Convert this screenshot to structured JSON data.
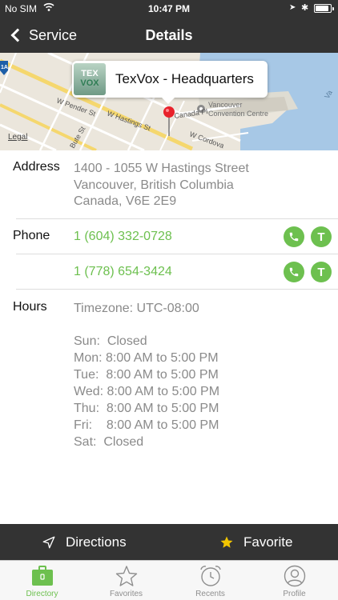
{
  "status_bar": {
    "carrier": "No SIM",
    "wifi_icon": "wifi-icon",
    "time": "10:47 PM",
    "battery_level": 0.9
  },
  "nav": {
    "back_label": "Service",
    "title": "Details"
  },
  "map": {
    "callout_title": "TexVox - Headquarters",
    "logo_text_line1": "TEX",
    "logo_text_line2": "VOX",
    "legal_label": "Legal",
    "street_labels": [
      "W Pender St",
      "W Hastings St",
      "Canada Pl",
      "W Cordova",
      "Bute St"
    ],
    "poi_label_line1": "Vancouver",
    "poi_label_line2": "Convention Centre",
    "highway_badge": "1A",
    "edge_label": "Va"
  },
  "address": {
    "label": "Address",
    "line1": "1400 - 1055 W Hastings Street",
    "line2": "Vancouver, British Columbia",
    "line3": "Canada, V6E 2E9"
  },
  "phone": {
    "label": "Phone",
    "numbers": [
      "1 (604) 332-0728",
      "1 (778) 654-3424"
    ],
    "text_glyph": "T"
  },
  "hours": {
    "label": "Hours",
    "timezone": "Timezone: UTC-08:00",
    "days": [
      {
        "day": "Sun:",
        "time": "Closed"
      },
      {
        "day": "Mon:",
        "time": "8:00 AM to 5:00 PM"
      },
      {
        "day": "Tue:",
        "time": "8:00 AM to 5:00 PM"
      },
      {
        "day": "Wed:",
        "time": "8:00 AM to 5:00 PM"
      },
      {
        "day": "Thu:",
        "time": "8:00 AM to 5:00 PM"
      },
      {
        "day": "Fri:",
        "time": "8:00 AM to 5:00 PM"
      },
      {
        "day": "Sat:",
        "time": "Closed"
      }
    ]
  },
  "actions": {
    "directions_label": "Directions",
    "favorite_label": "Favorite"
  },
  "tabs": [
    {
      "label": "Directory",
      "icon": "briefcase-icon",
      "active": true
    },
    {
      "label": "Favorites",
      "icon": "star-icon",
      "active": false
    },
    {
      "label": "Recents",
      "icon": "alarm-clock-icon",
      "active": false
    },
    {
      "label": "Profile",
      "icon": "person-icon",
      "active": false
    }
  ],
  "colors": {
    "bar_background": "#333333",
    "accent_green": "#6dc04f",
    "favorite_star": "#f2c500",
    "secondary_text": "#8a8a8a"
  }
}
